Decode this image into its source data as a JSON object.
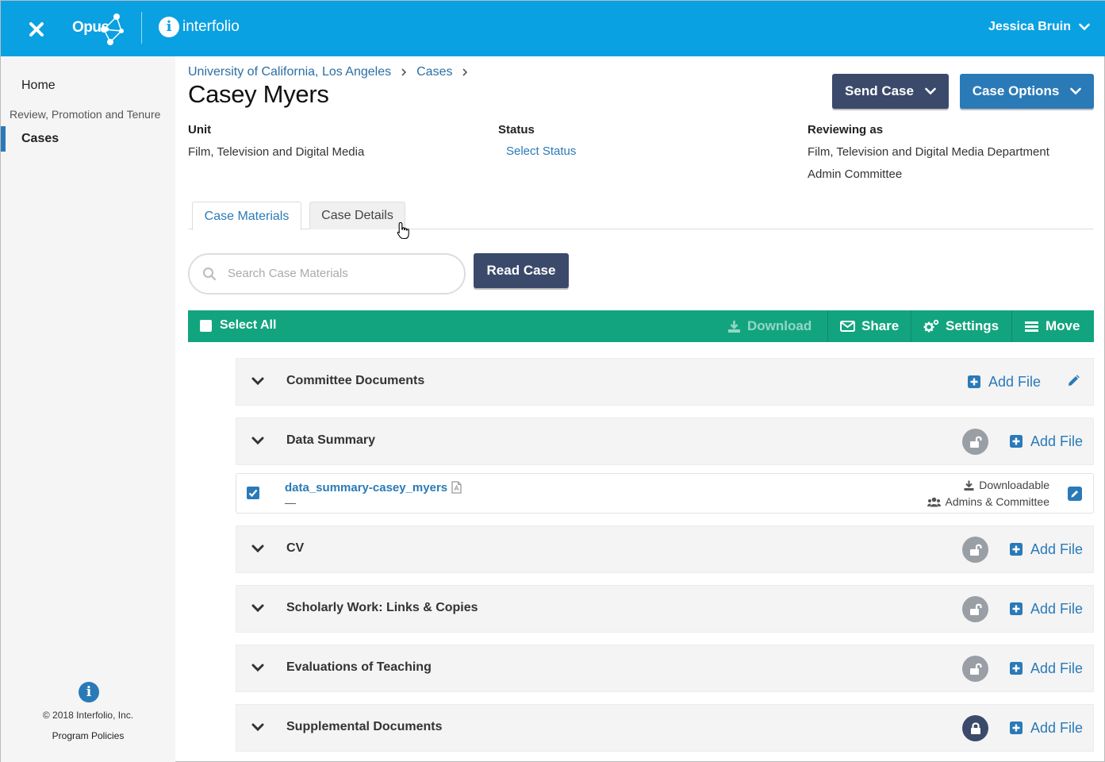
{
  "header": {
    "logo_text": "Opus",
    "brand": "interfolio",
    "user_name": "Jessica Bruin"
  },
  "sidebar": {
    "home": "Home",
    "section_label": "Review, Promotion and Tenure",
    "cases": "Cases",
    "copyright": "© 2018 Interfolio, Inc.",
    "policies": "Program Policies"
  },
  "breadcrumb": {
    "item1": "University of California, Los Angeles",
    "item2": "Cases"
  },
  "page": {
    "title": "Casey Myers",
    "send_case": "Send Case",
    "case_options": "Case Options"
  },
  "meta": {
    "unit_label": "Unit",
    "unit_value": "Film, Television and Digital Media",
    "status_label": "Status",
    "status_value": "Select Status",
    "reviewing_label": "Reviewing as",
    "reviewing_line1": "Film, Television and Digital Media Department",
    "reviewing_line2": "Admin Committee"
  },
  "tabs": {
    "materials": "Case Materials",
    "details": "Case Details"
  },
  "search": {
    "placeholder": "Search Case Materials",
    "read_case": "Read Case"
  },
  "toolbar": {
    "select_all": "Select All",
    "download": "Download",
    "share": "Share",
    "settings": "Settings",
    "move": "Move"
  },
  "sections": [
    {
      "title": "Committee Documents",
      "add_file": "Add File"
    },
    {
      "title": "Data Summary",
      "add_file": "Add File"
    },
    {
      "title": "CV",
      "add_file": "Add File"
    },
    {
      "title": "Scholarly Work: Links & Copies",
      "add_file": "Add File"
    },
    {
      "title": "Evaluations of Teaching",
      "add_file": "Add File"
    },
    {
      "title": "Supplemental Documents",
      "add_file": "Add File"
    }
  ],
  "file": {
    "name": "data_summary-casey_myers",
    "description": "—",
    "download_status": "Downloadable",
    "visibility": "Admins & Committee"
  },
  "colors": {
    "topbar": "#0aa1e2",
    "toolbar": "#12a47f",
    "primary_dark": "#3b4a6b",
    "primary_blue": "#2a7ab8"
  }
}
